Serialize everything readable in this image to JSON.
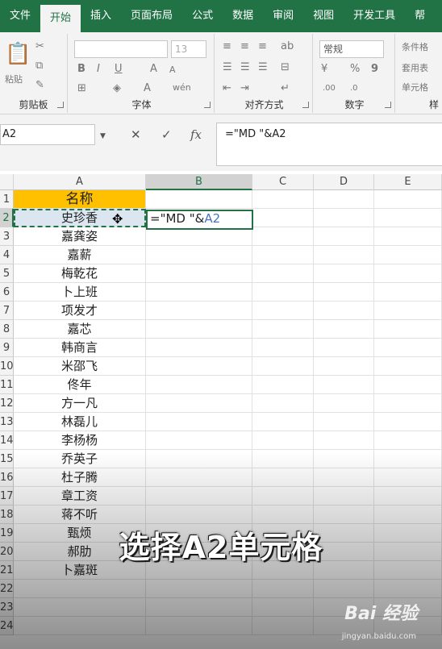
{
  "ribbon_tabs": [
    "文件",
    "开始",
    "插入",
    "页面布局",
    "公式",
    "数据",
    "审阅",
    "视图",
    "开发工具",
    "帮"
  ],
  "active_tab": 1,
  "groups": {
    "clipboard": "剪贴板",
    "paste": "粘贴",
    "font": "字体",
    "font_size": "13",
    "align": "对齐方式",
    "number": "数字",
    "number_format": "常规",
    "styles": "样",
    "cond_format": "条件格",
    "table_format": "套用表",
    "cell_style": "单元格"
  },
  "formula_bar": {
    "name_box": "A2",
    "cancel": "✕",
    "enter": "✓",
    "fx": "fx",
    "formula": "=\"MD \"&A2"
  },
  "columns": [
    "A",
    "B",
    "C",
    "D",
    "E"
  ],
  "selected_column": "B",
  "rows": [
    "1",
    "2",
    "3",
    "4",
    "5",
    "6",
    "7",
    "8",
    "9",
    "10",
    "11",
    "12",
    "13",
    "14",
    "15",
    "16",
    "17",
    "18",
    "19",
    "20",
    "21",
    "22",
    "23",
    "24"
  ],
  "selected_row": "2",
  "cells": {
    "A1": "名称",
    "A": [
      "史珍香",
      "嘉龚姿",
      "嘉薪",
      "梅乾花",
      "卜上班",
      "项发才",
      "嘉芯",
      "韩商言",
      "米邵飞",
      "佟年",
      "方一凡",
      "林磊儿",
      "李杨杨",
      "乔英子",
      "杜子腾",
      "章工资",
      "蒋不听",
      "甄烦",
      "郝肋",
      "卜嘉斑"
    ],
    "B2_formula": "=\"MD \"&",
    "B2_ref": "A2"
  },
  "caption": "选择A2单元格",
  "watermark": "Bai 经验",
  "watermark_url": "jingyan.baidu.com",
  "colors": {
    "accent": "#217346",
    "header_fill": "#ffc000",
    "ref_blue": "#4472c4"
  }
}
